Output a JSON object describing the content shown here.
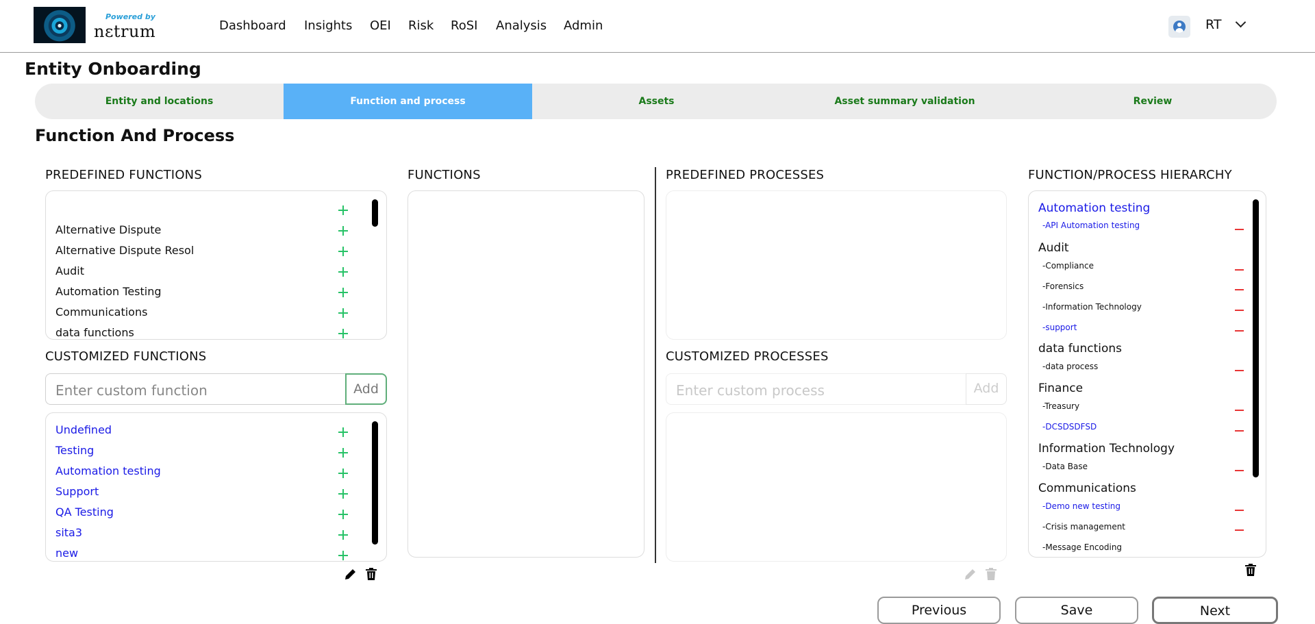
{
  "header": {
    "powered_by": "Powered by",
    "brand": "nɛtrum",
    "nav": [
      "Dashboard",
      "Insights",
      "OEI",
      "Risk",
      "RoSI",
      "Analysis",
      "Admin"
    ],
    "user_initials": "RT"
  },
  "page_title": "Entity Onboarding",
  "steps": [
    "Entity and locations",
    "Function and process",
    "Assets",
    "Asset summary validation",
    "Review"
  ],
  "active_step": "Function and process",
  "section_title": "Function And Process",
  "predefined_functions": {
    "title": "PREDEFINED FUNCTIONS",
    "items": [
      "",
      "Alternative Dispute",
      "Alternative Dispute Resol",
      "Audit",
      "Automation Testing",
      "Communications",
      "data functions"
    ]
  },
  "customized_functions": {
    "title": "CUSTOMIZED FUNCTIONS",
    "placeholder": "Enter custom function",
    "add_label": "Add",
    "items": [
      "Undefined",
      "Testing",
      "Automation testing",
      "Support",
      "QA Testing",
      "sita3",
      "new"
    ]
  },
  "functions": {
    "title": "FUNCTIONS"
  },
  "predefined_processes": {
    "title": "PREDEFINED PROCESSES"
  },
  "customized_processes": {
    "title": "CUSTOMIZED PROCESSES",
    "placeholder": "Enter custom process",
    "add_label": "Add"
  },
  "hierarchy": {
    "title": "FUNCTION/PROCESS HIERARCHY",
    "groups": [
      {
        "name": "Automation testing",
        "name_color": "blue",
        "children": [
          {
            "label": "-API Automation testing",
            "color": "blue"
          }
        ]
      },
      {
        "name": "Audit",
        "children": [
          {
            "label": "-Compliance"
          },
          {
            "label": "-Forensics"
          },
          {
            "label": "-Information Technology"
          },
          {
            "label": "-support",
            "color": "blue"
          }
        ]
      },
      {
        "name": "data functions",
        "children": [
          {
            "label": "-data process"
          }
        ]
      },
      {
        "name": "Finance",
        "children": [
          {
            "label": "-Treasury"
          },
          {
            "label": "-DCSDSDFSD",
            "color": "blue"
          }
        ]
      },
      {
        "name": "Information Technology",
        "children": [
          {
            "label": "-Data Base"
          }
        ]
      },
      {
        "name": "Communications",
        "children": [
          {
            "label": "-Demo new testing",
            "color": "blue"
          },
          {
            "label": "-Crisis management"
          },
          {
            "label": "-Message Encoding"
          }
        ]
      }
    ]
  },
  "buttons": {
    "previous": "Previous",
    "save": "Save",
    "next": "Next"
  },
  "colors": {
    "active_step": "#59b1f7",
    "step_text": "#1a7a1a",
    "add_icon": "#27c267",
    "remove_icon": "#e83535",
    "custom_text": "#1a1ae6"
  }
}
